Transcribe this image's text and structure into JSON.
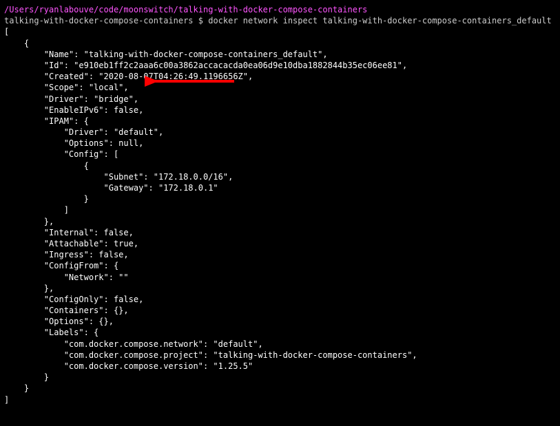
{
  "terminal": {
    "cwd": "/Users/ryanlabouve/code/moonswitch/talking-with-docker-compose-containers",
    "prompt_prefix": "talking-with-docker-compose-containers $ ",
    "command": "docker network inspect talking-with-docker-compose-containers_default",
    "output": "[\n    {\n        \"Name\": \"talking-with-docker-compose-containers_default\",\n        \"Id\": \"e910eb1ff2c2aaa6c00a3862accacacda0ea06d9e10dba1882844b35ec06ee81\",\n        \"Created\": \"2020-08-07T04:26:49.1196656Z\",\n        \"Scope\": \"local\",\n        \"Driver\": \"bridge\",\n        \"EnableIPv6\": false,\n        \"IPAM\": {\n            \"Driver\": \"default\",\n            \"Options\": null,\n            \"Config\": [\n                {\n                    \"Subnet\": \"172.18.0.0/16\",\n                    \"Gateway\": \"172.18.0.1\"\n                }\n            ]\n        },\n        \"Internal\": false,\n        \"Attachable\": true,\n        \"Ingress\": false,\n        \"ConfigFrom\": {\n            \"Network\": \"\"\n        },\n        \"ConfigOnly\": false,\n        \"Containers\": {},\n        \"Options\": {},\n        \"Labels\": {\n            \"com.docker.compose.network\": \"default\",\n            \"com.docker.compose.project\": \"talking-with-docker-compose-containers\",\n            \"com.docker.compose.version\": \"1.25.5\"\n        }\n    }\n]"
  }
}
